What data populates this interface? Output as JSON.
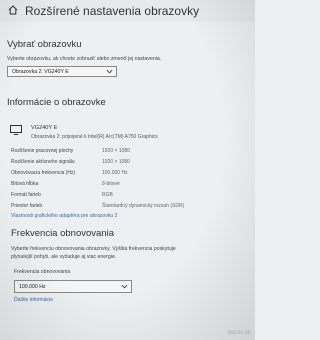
{
  "title": "Rozšírené nastavenia obrazovky",
  "select_display": {
    "heading": "Vybrať obrazovku",
    "description": "Vyberte obrazovku, ak chcete zobraziť alebo zmeniť jej nastavenia.",
    "selected": "Obrazovka 2: VG240Y E"
  },
  "display_info": {
    "heading": "Informácie o obrazovke",
    "monitor_name": "VG240Y E",
    "monitor_sub": "Obrazovka 2: pripojené k Intel(R) Arc(TM) A750 Graphics",
    "properties": [
      {
        "label": "Rozlíšenie pracovnej plochy",
        "value": "1920 × 1080"
      },
      {
        "label": "Rozlíšenie aktívneho signálu",
        "value": "1920 × 1080"
      },
      {
        "label": "Obnovovacia frekvencia (Hz)",
        "value": "100.000 Hz"
      },
      {
        "label": "Bitová hĺbka",
        "value": "8-bitové"
      },
      {
        "label": "Formát farieb",
        "value": "RGB"
      },
      {
        "label": "Priestor farieb",
        "value": "Štandardný dynamický rozsah (SDR)"
      }
    ],
    "adapter_link": "Vlastnosti grafického adaptéra pre obrazovku 2"
  },
  "refresh_rate": {
    "heading": "Frekvencia obnovovania",
    "description_line1": "Vyberte frekvenciu obnovovania obrazovky. Vyššia frekvencia poskytuje",
    "description_line2": "plynulejší pohyb, ale vyžaduje aj viac energie.",
    "field_label": "Frekvencia obnovovania",
    "selected": "100.000 Hz",
    "more_link": "Ďalšie informácie"
  },
  "watermark": "bazos.sk",
  "icons": {
    "home": "home-icon",
    "monitor": "monitor-icon",
    "chevron": "chevron-down-icon"
  },
  "colors": {
    "background": "#eeeff0",
    "link": "#2a6fb5",
    "text": "#2b2b2b"
  }
}
